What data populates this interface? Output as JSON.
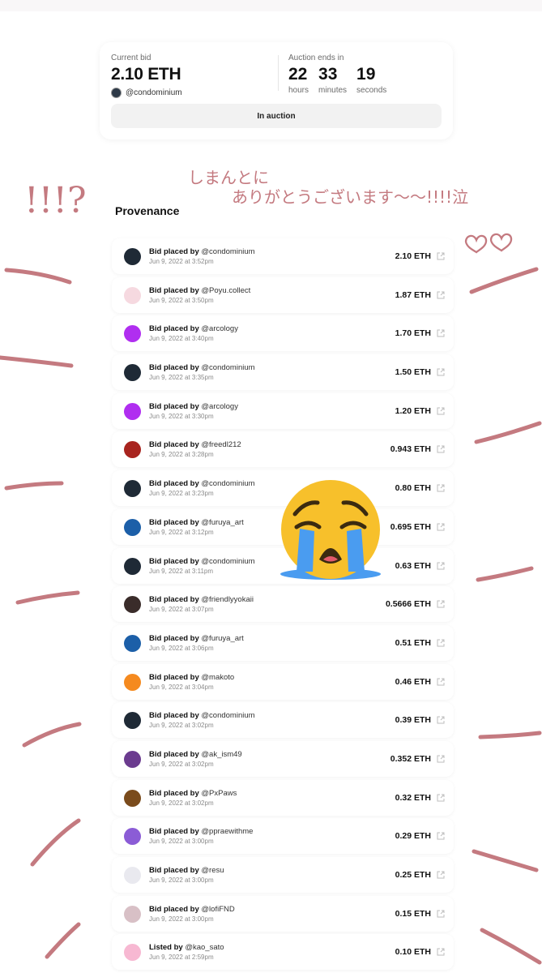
{
  "auction": {
    "current_bid_label": "Current bid",
    "current_bid": "2.10 ETH",
    "current_bidder": "@condominium",
    "ends_label": "Auction ends in",
    "countdown": [
      {
        "value": "22",
        "unit": "hours"
      },
      {
        "value": "33",
        "unit": "minutes"
      },
      {
        "value": "19",
        "unit": "seconds"
      }
    ],
    "status": "In auction"
  },
  "provenance": {
    "title": "Provenance",
    "bids": [
      {
        "action": "Bid placed by",
        "user": "@condominium",
        "date": "Jun 9, 2022 at 3:52pm",
        "amount": "2.10 ETH",
        "avatar": "#1f2a36"
      },
      {
        "action": "Bid placed by",
        "user": "@Poyu.collect",
        "date": "Jun 9, 2022 at 3:50pm",
        "amount": "1.87 ETH",
        "avatar": "#f6d9e0"
      },
      {
        "action": "Bid placed by",
        "user": "@arcology",
        "date": "Jun 9, 2022 at 3:40pm",
        "amount": "1.70 ETH",
        "avatar": "#b02ef0"
      },
      {
        "action": "Bid placed by",
        "user": "@condominium",
        "date": "Jun 9, 2022 at 3:35pm",
        "amount": "1.50 ETH",
        "avatar": "#1f2a36"
      },
      {
        "action": "Bid placed by",
        "user": "@arcology",
        "date": "Jun 9, 2022 at 3:30pm",
        "amount": "1.20 ETH",
        "avatar": "#b02ef0"
      },
      {
        "action": "Bid placed by",
        "user": "@freedl212",
        "date": "Jun 9, 2022 at 3:28pm",
        "amount": "0.943 ETH",
        "avatar": "#a8241f"
      },
      {
        "action": "Bid placed by",
        "user": "@condominium",
        "date": "Jun 9, 2022 at 3:23pm",
        "amount": "0.80 ETH",
        "avatar": "#1f2a36"
      },
      {
        "action": "Bid placed by",
        "user": "@furuya_art",
        "date": "Jun 9, 2022 at 3:12pm",
        "amount": "0.695 ETH",
        "avatar": "#1c5fa8"
      },
      {
        "action": "Bid placed by",
        "user": "@condominium",
        "date": "Jun 9, 2022 at 3:11pm",
        "amount": "0.63 ETH",
        "avatar": "#1f2a36"
      },
      {
        "action": "Bid placed by",
        "user": "@friendlyyokaii",
        "date": "Jun 9, 2022 at 3:07pm",
        "amount": "0.5666 ETH",
        "avatar": "#3a2c2a"
      },
      {
        "action": "Bid placed by",
        "user": "@furuya_art",
        "date": "Jun 9, 2022 at 3:06pm",
        "amount": "0.51 ETH",
        "avatar": "#1c5fa8"
      },
      {
        "action": "Bid placed by",
        "user": "@makoto",
        "date": "Jun 9, 2022 at 3:04pm",
        "amount": "0.46 ETH",
        "avatar": "#f58a1f"
      },
      {
        "action": "Bid placed by",
        "user": "@condominium",
        "date": "Jun 9, 2022 at 3:02pm",
        "amount": "0.39 ETH",
        "avatar": "#1f2a36"
      },
      {
        "action": "Bid placed by",
        "user": "@ak_ism49",
        "date": "Jun 9, 2022 at 3:02pm",
        "amount": "0.352 ETH",
        "avatar": "#6b3b8f"
      },
      {
        "action": "Bid placed by",
        "user": "@PxPaws",
        "date": "Jun 9, 2022 at 3:02pm",
        "amount": "0.32 ETH",
        "avatar": "#7a4b1c"
      },
      {
        "action": "Bid placed by",
        "user": "@ppraewithme",
        "date": "Jun 9, 2022 at 3:00pm",
        "amount": "0.29 ETH",
        "avatar": "#8b5cd6"
      },
      {
        "action": "Bid placed by",
        "user": "@resu",
        "date": "Jun 9, 2022 at 3:00pm",
        "amount": "0.25 ETH",
        "avatar": "#e9e9ef"
      },
      {
        "action": "Bid placed by",
        "user": "@lofiFND",
        "date": "Jun 9, 2022 at 3:00pm",
        "amount": "0.15 ETH",
        "avatar": "#d8c0c6"
      },
      {
        "action": "Listed by",
        "user": "@kao_sato",
        "date": "Jun 9, 2022 at 2:59pm",
        "amount": "0.10 ETH",
        "avatar": "#f7b8d2"
      }
    ]
  },
  "annotations": {
    "exclaim_text": "!!!?",
    "thanks_line1": "しまんとに",
    "thanks_line2": "ありがとうございます〜〜!!!!泣",
    "ink_color": "#c47a80"
  }
}
